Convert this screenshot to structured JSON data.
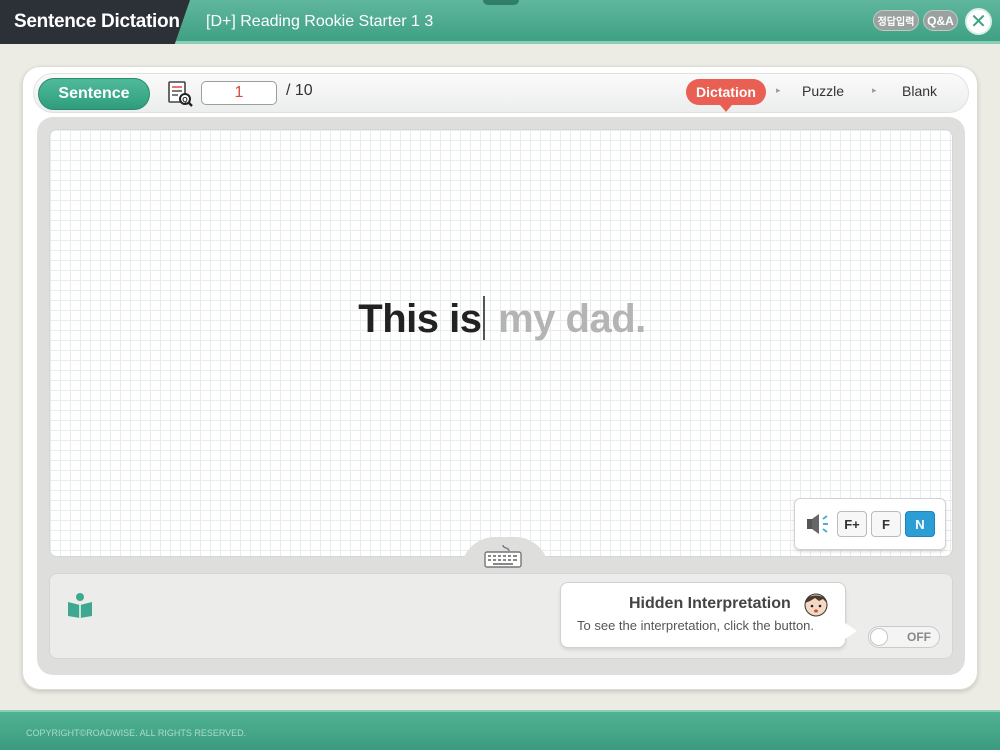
{
  "header": {
    "app_title": "Sentence Dictation",
    "course_title": "[D+] Reading Rookie Starter 1 3",
    "answer_button": "정답입력",
    "qa_button": "Q&A",
    "close_icon": "close-icon"
  },
  "toolbar": {
    "mode_button": "Sentence",
    "page_icon": "document-search-icon",
    "current_page": "1",
    "total_pages": "/ 10",
    "steps": [
      {
        "label": "Dictation",
        "active": true
      },
      {
        "label": "Puzzle",
        "active": false
      },
      {
        "label": "Blank",
        "active": false
      }
    ],
    "step_arrow": "▸"
  },
  "sentence": {
    "typed": "This is",
    "remaining": " my dad."
  },
  "audio": {
    "speaker_icon": "speaker-icon",
    "speeds": [
      {
        "label": "F+",
        "active": false
      },
      {
        "label": "F",
        "active": false
      },
      {
        "label": "N",
        "active": true
      }
    ]
  },
  "keyboard_icon": "keyboard-icon",
  "interpretation": {
    "book_icon": "book-icon",
    "title": "Hidden Interpretation",
    "description": "To see the interpretation, click the button.",
    "face_icon": "face-icon",
    "toggle_state": "OFF"
  },
  "footer": {
    "copyright": "COPYRIGHT©ROADWISE. ALL RIGHTS RESERVED."
  },
  "colors": {
    "brand_green": "#3fa084",
    "header_dark": "#2c3138",
    "active_step": "#ea5f53",
    "active_speed": "#2b9ed6",
    "page_number": "#d94a3c"
  }
}
